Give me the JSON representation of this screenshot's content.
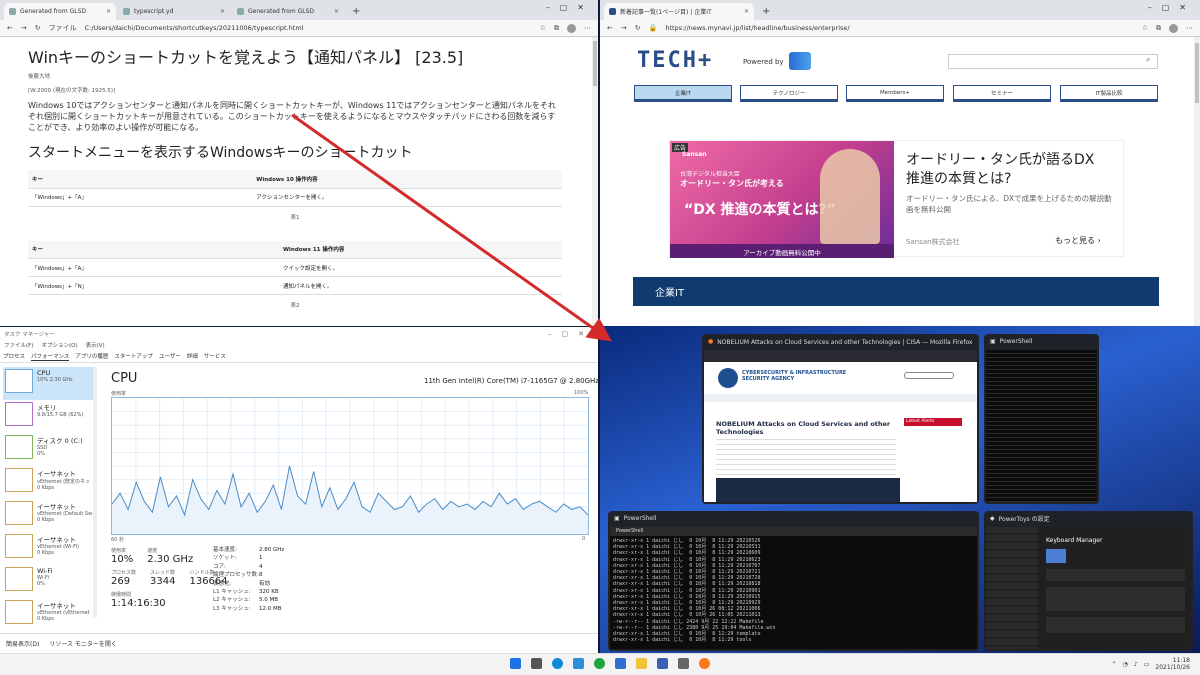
{
  "left_browser": {
    "tabs": [
      "Generated from GLSD",
      "typescript.yd",
      "Generated from GLSD"
    ],
    "address_label": "ファイル",
    "url": "C:/Users/daichi/Documents/shortcutkeys/20211006/typescript.html",
    "doc": {
      "title": "Winキーのショートカットを覚えよう【通知パネル】 [23.5]",
      "author": "後藤大地",
      "meta": "[W:2000 (現在の文字数: 1925.5)]",
      "intro": "Windows 10ではアクションセンターと通知パネルを同時に開くショートカットキーが、Windows 11ではアクションセンターと通知パネルをそれぞれ個別に開くショートカットキーが用意されている。このショートカットキーを使えるようになるとマウスやタッチパッドにさわる回数を減らすことができ、より効率のよい操作が可能になる。",
      "section": "スタートメニューを表示するWindowsキーのショートカット",
      "table1": {
        "headers": [
          "キー",
          "Windows 10 操作内容"
        ],
        "rows": [
          [
            "「Windows」+「A」",
            "アクションセンターを開く。"
          ]
        ],
        "caption": "表1"
      },
      "table2": {
        "headers": [
          "キー",
          "Windows 11 操作内容"
        ],
        "rows": [
          [
            "「Windows」+「A」",
            "クイック設定を開く。"
          ],
          [
            "「Windows」+「N」",
            "通知パネルを開く。"
          ]
        ],
        "caption": "表2"
      }
    }
  },
  "right_browser": {
    "tab": "新着記事一覧(1ページ目) | 企業IT",
    "url": "https://news.mynavi.jp/list/headline/business/enterprise/",
    "logo": "TECH+",
    "powered": "Powered by",
    "nav": [
      "企業IT",
      "テクノロジー",
      "Members+",
      "セミナー",
      "IT製品比較"
    ],
    "ad": {
      "label": "広告",
      "sponsor_tag": "Sansan",
      "img_line1": "台湾デジタル担当大臣",
      "img_line2": "オードリー・タン氏が考える",
      "img_big": "“DX 推進の本質とは?”",
      "img_banner": "アーカイブ動画無料公開中",
      "title": "オードリー・タン氏が語るDX推進の本質とは?",
      "desc": "オードリー・タン氏による、DXで成果を上げるための解説動画を無料公開",
      "company": "Sansan株式会社",
      "more": "もっと見る ›"
    },
    "section_bar": "企業IT"
  },
  "task_manager": {
    "title": "タスク マネージャー",
    "menu": [
      "ファイル(F)",
      "オプション(O)",
      "表示(V)"
    ],
    "tabs": [
      "プロセス",
      "パフォーマンス",
      "アプリの履歴",
      "スタートアップ",
      "ユーザー",
      "詳細",
      "サービス"
    ],
    "side": [
      {
        "name": "CPU",
        "sub": "10%  2.30 GHz"
      },
      {
        "name": "メモリ",
        "sub": "9.8/15.7 GB (62%)"
      },
      {
        "name": "ディスク 0 (C:)",
        "sub": "SSD\n0%"
      },
      {
        "name": "イーサネット",
        "sub": "vEthernet (既定のネッ\n0 Kbps"
      },
      {
        "name": "イーサネット",
        "sub": "vEthernet (Default Sw\n0 Kbps"
      },
      {
        "name": "イーサネット",
        "sub": "vEthernet (Wi-Fi)\n0 Kbps"
      },
      {
        "name": "Wi-Fi",
        "sub": "Wi-Fi\n0%"
      },
      {
        "name": "イーサネット",
        "sub": "vEthernet (vEthernet\n0 Kbps"
      }
    ],
    "heading": "CPU",
    "model": "11th Gen Intel(R) Core(TM) i7-1165G7 @ 2.80GHz",
    "graph_label": "使用率",
    "graph_max": "100%",
    "graph_span": "60 秒",
    "graph_min": "0",
    "stats": {
      "util_label": "使用率",
      "util": "10%",
      "speed_label": "速度",
      "speed": "2.30 GHz",
      "proc_label": "プロセス数",
      "proc": "269",
      "threads_label": "スレッド数",
      "threads": "3344",
      "handles_label": "ハンドル数",
      "handles": "136664",
      "uptime_label": "稼働時間",
      "uptime": "1:14:16:30"
    },
    "details": [
      [
        "基本速度:",
        "2.80 GHz"
      ],
      [
        "ソケット:",
        "1"
      ],
      [
        "コア:",
        "4"
      ],
      [
        "論理プロセッサ数:",
        "8"
      ],
      [
        "仮想化:",
        "有効"
      ],
      [
        "L1 キャッシュ:",
        "320 KB"
      ],
      [
        "L2 キャッシュ:",
        "5.0 MB"
      ],
      [
        "L3 キャッシュ:",
        "12.0 MB"
      ]
    ],
    "footer": [
      "簡易表示(D)",
      "リソース モニターを開く"
    ],
    "cpu_series": [
      22,
      30,
      18,
      38,
      24,
      16,
      42,
      20,
      28,
      14,
      40,
      26,
      18,
      32,
      22,
      44,
      20,
      30,
      16,
      24,
      36,
      18,
      50,
      28,
      22,
      46,
      20,
      34,
      18,
      26,
      38,
      20,
      16,
      30,
      24,
      18,
      20,
      28,
      16,
      22,
      26,
      18,
      24,
      20,
      22,
      18,
      24,
      20,
      30,
      22,
      26,
      18,
      22,
      24,
      20,
      16,
      22,
      18,
      20,
      14
    ]
  },
  "snap": {
    "firefox_title": "NOBELIUM Attacks on Cloud Services and other Technologies | CISA — Mozilla Firefox (プライベー...",
    "cisa_heading": "NOBELIUM Attacks on Cloud Services and other Technologies",
    "cisa_agency": "CYBERSECURITY & INFRASTRUCTURE SECURITY AGENCY",
    "cisa_alerts": "Latest Alerts",
    "ps_small_title": "PowerShell",
    "ps_big_title": "PowerShell",
    "ps_tab": "PowerShell",
    "ps_lines": [
      "drwxr-xr-x 1 daichi じし  0 10月  8 11:29 20210526",
      "drwxr-xr-x 1 daichi じし  0 10月  8 11:29 20210531",
      "drwxr-xr-x 1 daichi じし  0 10月  8 11:29 20210609",
      "drwxr-xr-x 1 daichi じし  0 10月  8 11:29 20210623",
      "drwxr-xr-x 1 daichi じし  0 10月  8 11:29 20210707",
      "drwxr-xr-x 1 daichi じし  0 10月  8 11:29 20210721",
      "drwxr-xr-x 1 daichi じし  0 10月  8 11:29 20210728",
      "drwxr-xr-x 1 daichi じし  0 10月  8 11:29 20210818",
      "drwxr-xr-x 1 daichi じし  0 10月  8 11:29 20210901",
      "drwxr-xr-x 1 daichi じし  0 10月  8 11:29 20210915",
      "drwxr-xr-x 1 daichi じし  0 10月  8 11:29 20210929",
      "drwxr-xr-x 1 daichi じし  0 10月 26 08:12 20211006",
      "drwxr-xr-x 1 daichi じし  0 10月 26 11:05 20211013",
      "-rw-r--r-- 1 daichi じし 2424 9月 22 12:22 Makefile",
      "-rw-r--r-- 1 daichi じし 2380 9月 25 19:04 Makefile.win",
      "drwxr-xr-x 1 daichi じし  0 10月  8 11:29 template",
      "drwxr-xr-x 1 daichi じし  0 10月  8 11:29 tools"
    ],
    "pt_title": "PowerToys の設定",
    "pt_heading": "Keyboard Manager"
  },
  "taskbar": {
    "time": "11:18",
    "date": "2021/10/26"
  },
  "colors": {
    "arrow": "#d42a2a",
    "accent": "#0f3b6e",
    "graph": "#4a8cc8"
  }
}
